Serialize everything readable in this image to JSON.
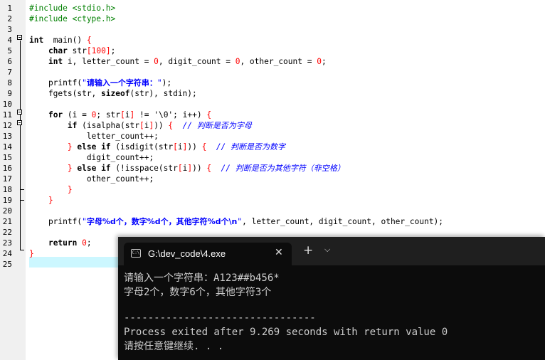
{
  "editor": {
    "lines": [
      {
        "n": "1",
        "tokens": [
          [
            "pp",
            "#include <stdio.h>"
          ]
        ]
      },
      {
        "n": "2",
        "tokens": [
          [
            "pp",
            "#include <ctype.h>"
          ]
        ]
      },
      {
        "n": "3",
        "tokens": []
      },
      {
        "n": "4",
        "tokens": [
          [
            "kw",
            "int"
          ],
          [
            "",
            "  main() "
          ],
          [
            "sym",
            "{"
          ]
        ]
      },
      {
        "n": "5",
        "tokens": [
          [
            "",
            "    "
          ],
          [
            "kw",
            "char"
          ],
          [
            "",
            " str"
          ],
          [
            "sym",
            "["
          ],
          [
            "num",
            "100"
          ],
          [
            "sym",
            "]"
          ],
          [
            "",
            ";"
          ]
        ]
      },
      {
        "n": "6",
        "tokens": [
          [
            "",
            "    "
          ],
          [
            "kw",
            "int"
          ],
          [
            "",
            " i, letter_count = "
          ],
          [
            "num",
            "0"
          ],
          [
            "",
            ", digit_count = "
          ],
          [
            "num",
            "0"
          ],
          [
            "",
            ", other_count = "
          ],
          [
            "num",
            "0"
          ],
          [
            "",
            ";"
          ]
        ]
      },
      {
        "n": "7",
        "tokens": []
      },
      {
        "n": "8",
        "tokens": [
          [
            "",
            "    printf("
          ],
          [
            "str",
            "\""
          ],
          [
            "zh",
            "请输入一个字符串："
          ],
          [
            "str",
            "\""
          ],
          [
            "",
            ");"
          ]
        ]
      },
      {
        "n": "9",
        "tokens": [
          [
            "",
            "    fgets(str, "
          ],
          [
            "kw",
            "sizeof"
          ],
          [
            "",
            "(str), stdin);"
          ]
        ]
      },
      {
        "n": "10",
        "tokens": []
      },
      {
        "n": "11",
        "tokens": [
          [
            "",
            "    "
          ],
          [
            "kw",
            "for"
          ],
          [
            "",
            " (i = "
          ],
          [
            "num",
            "0"
          ],
          [
            "",
            "; str"
          ],
          [
            "sym",
            "["
          ],
          [
            "",
            "i"
          ],
          [
            "sym",
            "]"
          ],
          [
            "",
            " != '\\0'; i++) "
          ],
          [
            "sym",
            "{"
          ]
        ]
      },
      {
        "n": "12",
        "tokens": [
          [
            "",
            "        "
          ],
          [
            "kw",
            "if"
          ],
          [
            "",
            " (isalpha(str"
          ],
          [
            "sym",
            "["
          ],
          [
            "",
            "i"
          ],
          [
            "sym",
            "]"
          ],
          [
            "",
            ")) "
          ],
          [
            "sym",
            "{"
          ],
          [
            "",
            "  "
          ],
          [
            "cmt",
            "// "
          ],
          [
            "cmtzh",
            "判断是否为字母"
          ]
        ]
      },
      {
        "n": "13",
        "tokens": [
          [
            "",
            "            letter_count++;"
          ]
        ]
      },
      {
        "n": "14",
        "tokens": [
          [
            "",
            "        "
          ],
          [
            "sym",
            "}"
          ],
          [
            "",
            " "
          ],
          [
            "kw",
            "else if"
          ],
          [
            "",
            " (isdigit(str"
          ],
          [
            "sym",
            "["
          ],
          [
            "",
            "i"
          ],
          [
            "sym",
            "]"
          ],
          [
            "",
            ")) "
          ],
          [
            "sym",
            "{"
          ],
          [
            "",
            "  "
          ],
          [
            "cmt",
            "// "
          ],
          [
            "cmtzh",
            "判断是否为数字"
          ]
        ]
      },
      {
        "n": "15",
        "tokens": [
          [
            "",
            "            digit_count++;"
          ]
        ]
      },
      {
        "n": "16",
        "tokens": [
          [
            "",
            "        "
          ],
          [
            "sym",
            "}"
          ],
          [
            "",
            " "
          ],
          [
            "kw",
            "else if"
          ],
          [
            "",
            " (!isspace(str"
          ],
          [
            "sym",
            "["
          ],
          [
            "",
            "i"
          ],
          [
            "sym",
            "]"
          ],
          [
            "",
            ")) "
          ],
          [
            "sym",
            "{"
          ],
          [
            "",
            "  "
          ],
          [
            "cmt",
            "// "
          ],
          [
            "cmtzh",
            "判断是否为其他字符（非空格）"
          ]
        ]
      },
      {
        "n": "17",
        "tokens": [
          [
            "",
            "            other_count++;"
          ]
        ]
      },
      {
        "n": "18",
        "tokens": [
          [
            "",
            "        "
          ],
          [
            "sym",
            "}"
          ]
        ]
      },
      {
        "n": "19",
        "tokens": [
          [
            "",
            "    "
          ],
          [
            "sym",
            "}"
          ]
        ]
      },
      {
        "n": "20",
        "tokens": []
      },
      {
        "n": "21",
        "tokens": [
          [
            "",
            "    printf("
          ],
          [
            "str",
            "\""
          ],
          [
            "zh",
            "字母%d个，数字%d个，其他字符%d个\\n"
          ],
          [
            "str",
            "\""
          ],
          [
            "",
            ", letter_count, digit_count, other_count);"
          ]
        ]
      },
      {
        "n": "22",
        "tokens": []
      },
      {
        "n": "23",
        "tokens": [
          [
            "",
            "    "
          ],
          [
            "kw",
            "return"
          ],
          [
            "",
            " "
          ],
          [
            "num",
            "0"
          ],
          [
            "",
            ";"
          ]
        ]
      },
      {
        "n": "24",
        "tokens": [
          [
            "sym",
            "}"
          ]
        ]
      },
      {
        "n": "25",
        "tokens": []
      }
    ]
  },
  "terminal": {
    "tab_title": "G:\\dev_code\\4.exe",
    "tab_icon": "C:\\",
    "close_glyph": "✕",
    "new_tab_glyph": "+",
    "dropdown_glyph": "⌵",
    "output": [
      "请输入一个字符串：A123##b456*",
      "字母2个，数字6个，其他字符3个",
      "",
      "--------------------------------",
      "Process exited after 9.269 seconds with return value 0",
      "请按任意键继续. . ."
    ]
  }
}
